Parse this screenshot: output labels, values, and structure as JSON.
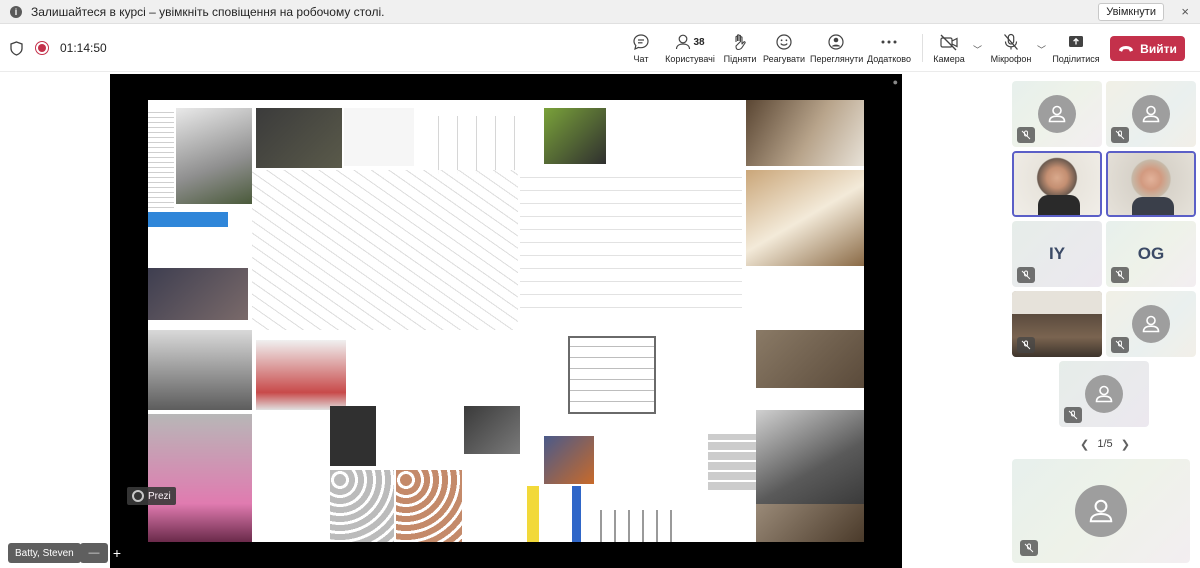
{
  "banner": {
    "message": "Залишайтеся в курсі – увімкніть сповіщення на робочому столі.",
    "enable_label": "Увімкнути",
    "close_glyph": "×"
  },
  "meeting": {
    "timer": "01:14:50",
    "recording": true
  },
  "toolbar": {
    "chat": "Чат",
    "participants": "Користувачі",
    "participants_count": "38",
    "raise": "Підняти",
    "react": "Реагувати",
    "view": "Переглянути",
    "more": "Додатково",
    "camera": "Камера",
    "mic": "Мікрофон",
    "share": "Поділитися",
    "leave": "Вийти"
  },
  "stage": {
    "presenter_name": "Batty, Steven",
    "prezi_label": "Prezi",
    "zoom_minus": "—",
    "zoom_plus": "+"
  },
  "gallery": {
    "tiles": [
      {
        "type": "avatar",
        "muted": true
      },
      {
        "type": "avatar",
        "muted": true
      },
      {
        "type": "video",
        "muted": false,
        "active": true
      },
      {
        "type": "video",
        "muted": false,
        "active": true
      },
      {
        "type": "initials",
        "initials": "IY",
        "muted": true
      },
      {
        "type": "initials",
        "initials": "OG",
        "muted": true
      },
      {
        "type": "video",
        "muted": true
      },
      {
        "type": "avatar",
        "muted": true
      },
      {
        "type": "avatar",
        "muted": true
      }
    ],
    "page_indicator": "1/5",
    "self_view": {
      "type": "avatar",
      "muted": true
    }
  },
  "colors": {
    "accent": "#5b5fc7",
    "leave": "#c4314b",
    "recording": "#c4314b"
  },
  "icons": [
    "info-icon",
    "shield-icon",
    "record-icon",
    "chat-icon",
    "people-icon",
    "hand-icon",
    "smiley-icon",
    "view-icon",
    "more-icon",
    "camera-off-icon",
    "mic-off-icon",
    "share-icon",
    "phone-icon",
    "person-icon",
    "chevron-left-icon",
    "chevron-right-icon"
  ]
}
